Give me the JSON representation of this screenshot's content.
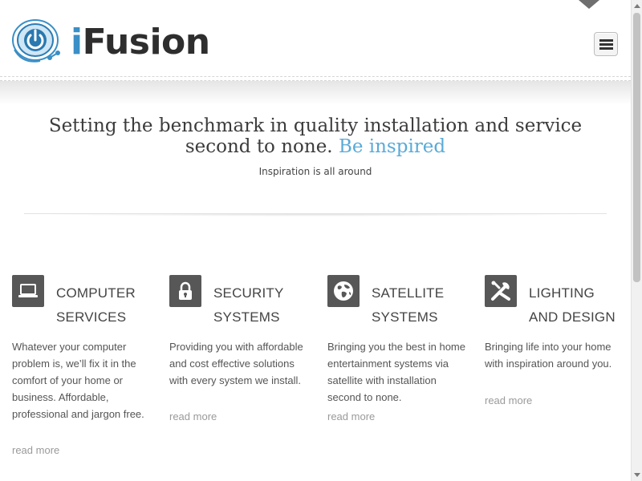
{
  "header": {
    "logo_i": "i",
    "logo_rest": "Fusion",
    "menu_label": "menu"
  },
  "hero": {
    "title_main": "Setting the benchmark in quality installation and service second to none.",
    "title_accent": "Be inspired",
    "subtitle": "Inspiration is all around"
  },
  "services": [
    {
      "title_line1": "COMPUTER",
      "title_line2": "SERVICES",
      "icon": "laptop-icon",
      "description": "Whatever your computer problem is, we’ll fix it in the comfort of your home or business. Affordable, professional and jargon free.",
      "more": "read more"
    },
    {
      "title_line1": "SECURITY",
      "title_line2": "SYSTEMS",
      "icon": "lock-icon",
      "description": "Providing you with affordable and cost effective solutions with every system we install.",
      "more": "read more"
    },
    {
      "title_line1": "SATELLITE",
      "title_line2": "SYSTEMS",
      "icon": "globe-icon",
      "description": "Bringing you the best in home entertainment systems via satellite with installation second to none.",
      "more": "read more"
    },
    {
      "title_line1": "LIGHTING",
      "title_line2": "AND DESIGN",
      "icon": "tools-icon",
      "description": "Bringing life into your home with inspiration around you.",
      "more": "read more"
    }
  ],
  "colors": {
    "brand_blue": "#3a8fc6",
    "accent_blue": "#5aaad8",
    "icon_bg": "#575757"
  }
}
